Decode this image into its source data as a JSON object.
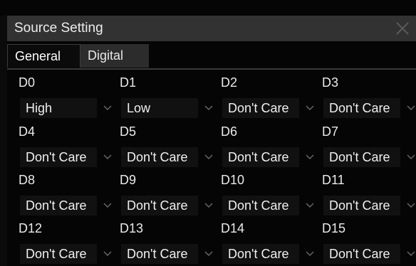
{
  "dialog": {
    "title": "Source Setting",
    "close_icon": "close-icon"
  },
  "tabs": [
    {
      "label": "General",
      "active": false
    },
    {
      "label": "Digital",
      "active": true
    }
  ],
  "channels": [
    {
      "label": "D0",
      "value": "High"
    },
    {
      "label": "D1",
      "value": "Low"
    },
    {
      "label": "D2",
      "value": "Don't Care"
    },
    {
      "label": "D3",
      "value": "Don't Care"
    },
    {
      "label": "D4",
      "value": "Don't Care"
    },
    {
      "label": "D5",
      "value": "Don't Care"
    },
    {
      "label": "D6",
      "value": "Don't Care"
    },
    {
      "label": "D7",
      "value": "Don't Care"
    },
    {
      "label": "D8",
      "value": "Don't Care"
    },
    {
      "label": "D9",
      "value": "Don't Care"
    },
    {
      "label": "D10",
      "value": "Don't Care"
    },
    {
      "label": "D11",
      "value": "Don't Care"
    },
    {
      "label": "D12",
      "value": "Don't Care"
    },
    {
      "label": "D13",
      "value": "Don't Care"
    },
    {
      "label": "D14",
      "value": "Don't Care"
    },
    {
      "label": "D15",
      "value": "Don't Care"
    }
  ],
  "colors": {
    "titlebar": "#323232",
    "background": "#050505",
    "select_bg": "#111111",
    "text": "#e8e8e8"
  }
}
